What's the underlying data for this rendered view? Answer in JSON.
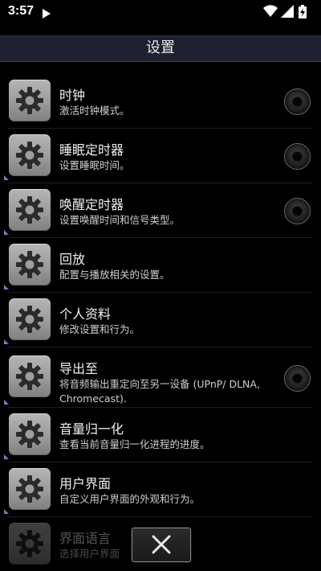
{
  "status_bar": {
    "time": "3:57",
    "icons": [
      "play-icon",
      "wifi-icon",
      "signal-icon",
      "battery-charging-icon"
    ]
  },
  "header": {
    "title": "设置"
  },
  "settings": [
    {
      "title": "时钟",
      "subtitle": "激活时钟模式。",
      "icon": "gear-icon",
      "has_radio": true,
      "submenu_corner": false
    },
    {
      "title": "睡眠定时器",
      "subtitle": "设置睡眠时间。",
      "icon": "gear-icon",
      "has_radio": true,
      "submenu_corner": true
    },
    {
      "title": "唤醒定时器",
      "subtitle": "设置唤醒时间和信号类型。",
      "icon": "gear-icon",
      "has_radio": true,
      "submenu_corner": true
    },
    {
      "title": "回放",
      "subtitle": "配置与播放相关的设置。",
      "icon": "gear-icon",
      "has_radio": false,
      "submenu_corner": true
    },
    {
      "title": "个人资料",
      "subtitle": "修改设置和行为。",
      "icon": "gear-icon",
      "has_radio": false,
      "submenu_corner": true
    },
    {
      "title": "导出至",
      "subtitle": "将音频输出重定向至另一设备 (UPnP/ DLNA, Chromecast).",
      "icon": "gear-icon",
      "has_radio": true,
      "submenu_corner": true
    },
    {
      "title": "音量归一化",
      "subtitle": "查看当前音量归一化进程的进度。",
      "icon": "gear-icon",
      "has_radio": false,
      "submenu_corner": true
    },
    {
      "title": "用户界面",
      "subtitle": "自定义用户界面的外观和行为。",
      "icon": "gear-icon",
      "has_radio": false,
      "submenu_corner": true
    },
    {
      "title": "界面语言",
      "subtitle": "选择用户界面",
      "icon": "gear-icon",
      "has_radio": false,
      "submenu_corner": true
    }
  ],
  "close_button": {
    "icon": "close-icon"
  },
  "colors": {
    "title_bar": "#1d2130",
    "background": "#000000",
    "tile": "#a5a5a5",
    "corner_accent": "#6f7fc0"
  }
}
